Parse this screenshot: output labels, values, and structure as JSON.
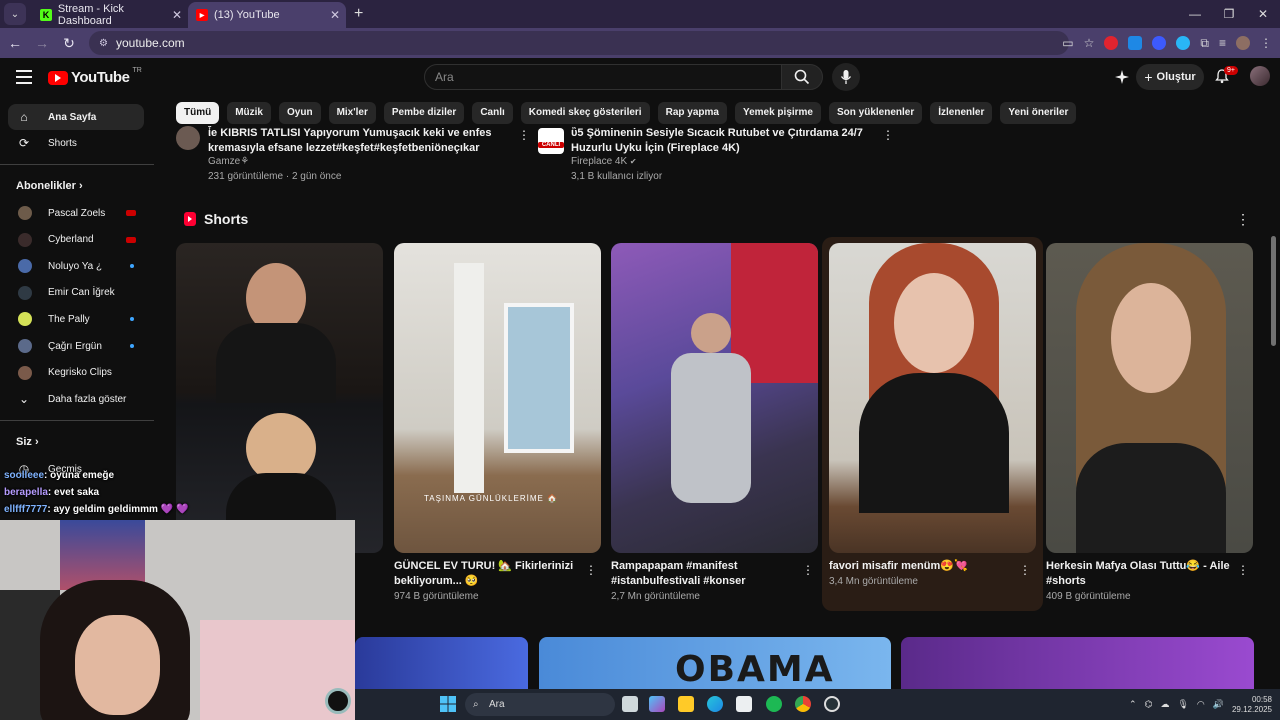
{
  "browser": {
    "tabs": [
      {
        "title": "Stream - Kick Dashboard",
        "active": false
      },
      {
        "title": "(13) YouTube",
        "active": true
      }
    ],
    "url": "youtube.com"
  },
  "header": {
    "logo_text": "YouTube",
    "country_code": "TR",
    "search_placeholder": "Ara",
    "create_label": "Oluştur",
    "notifications_badge": "9+"
  },
  "chips": [
    "Tümü",
    "Müzik",
    "Oyun",
    "Mix'ler",
    "Pembe diziler",
    "Canlı",
    "Komedi skeç gösterileri",
    "Rap yapma",
    "Yemek pişirme",
    "Son yüklenenler",
    "İzlenenler",
    "Yeni öneriler"
  ],
  "sidebar": {
    "main": [
      {
        "label": "Ana Sayfa",
        "icon": "home-icon"
      },
      {
        "label": "Shorts",
        "icon": "shorts-icon"
      }
    ],
    "subscriptions_title": "Abonelikler",
    "subscriptions": [
      {
        "label": "Pascal Zoels",
        "status": "live",
        "avatar_color": "#6d5b4a"
      },
      {
        "label": "Cyberland",
        "status": "live",
        "avatar_color": "#3a2b2b"
      },
      {
        "label": "Noluyo Ya ¿",
        "status": "new",
        "avatar_color": "#4a6aa8"
      },
      {
        "label": "Emir Can İğrek",
        "status": "",
        "avatar_color": "#2f3a44"
      },
      {
        "label": "The Pally",
        "status": "new",
        "avatar_color": "#d4e157"
      },
      {
        "label": "Çağrı Ergün",
        "status": "new",
        "avatar_color": "#5b6a8a"
      },
      {
        "label": "Kegrisko Clips",
        "status": "",
        "avatar_color": "#7a5a4a"
      }
    ],
    "show_more": "Daha fazla göster",
    "you_title": "Siz",
    "history": "Geçmiş"
  },
  "top_videos": [
    {
      "title_line1": "ἶe KIBRIS TATLISI Yapıyorum Yumuşacık keki ve enfes",
      "title_line2": "kremasıyla efsane lezzet#keşfet#keşfetbeniöneçıkar",
      "channel": "Gamze⚘",
      "meta": "231 görüntüleme · 2 gün önce"
    },
    {
      "title_line1": "ὒ5 Şöminenin Sesiyle Sıcacık Rutubet ve Çıtırdama 24/7 LIVE,",
      "title_line2": "Huzurlu Uyku İçin (Fireplace 4K)",
      "channel": "Fireplace 4K",
      "meta": "3,1 B kullanıcı izliyor",
      "badge": "CANLI"
    }
  ],
  "shorts": {
    "title": "Shorts",
    "items": [
      {
        "title": "",
        "views": ""
      },
      {
        "title_line1": "GÜNCEL EV TURU! 🏡 Fikirlerinizi",
        "title_line2": "bekliyorum... 🥺",
        "views": "974 B görüntüleme",
        "overlay": "TAŞINMA GÜNLÜKLERİME 🏠"
      },
      {
        "title_line1": "Rampapapam #manifest",
        "title_line2": "#istanbulfestivali #konser",
        "views": "2,7 Mn görüntüleme"
      },
      {
        "title_line1": "favori misafir menüm😍💘",
        "title_line2": "",
        "views": "3,4 Mn görüntüleme"
      },
      {
        "title_line1": "Herkesin Mafya Olası Tuttu😂 - Aile",
        "title_line2": "#shorts",
        "views": "409 B görüntüleme"
      }
    ]
  },
  "bottom_thumb_text": "OBAMA",
  "chat": [
    {
      "user": "soolleee",
      "text": ": oyuna emeğe"
    },
    {
      "user": "berapella",
      "text": ": evet saka"
    },
    {
      "user": "ellfff7777",
      "text": ": ayy geldim geldimmm 💜 💜"
    }
  ],
  "taskbar": {
    "search_label": "Ara",
    "time": "00:58",
    "date": "29.12.2025"
  }
}
